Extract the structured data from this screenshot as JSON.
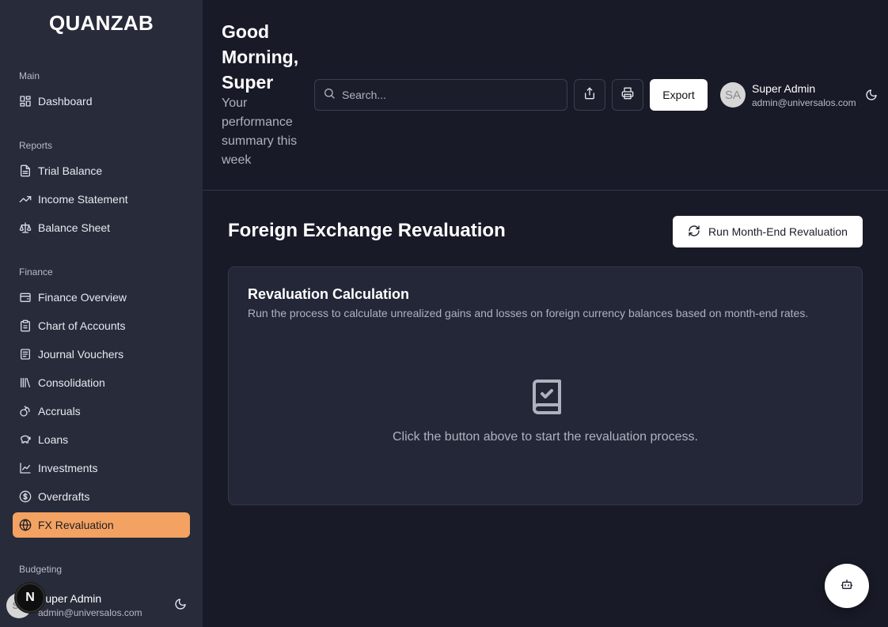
{
  "app": {
    "name": "QUANZAB"
  },
  "sidebar": {
    "sections": {
      "main": "Main",
      "reports": "Reports",
      "finance": "Finance",
      "budgeting": "Budgeting"
    },
    "items": {
      "dashboard": {
        "label": "Dashboard",
        "icon": "layout-dashboard-icon"
      },
      "trial_balance": {
        "label": "Trial Balance",
        "icon": "file-text-icon"
      },
      "income_statement": {
        "label": "Income Statement",
        "icon": "trending-up-icon"
      },
      "balance_sheet": {
        "label": "Balance Sheet",
        "icon": "scale-icon"
      },
      "finance_overview": {
        "label": "Finance Overview",
        "icon": "wallet-icon"
      },
      "chart_of_accounts": {
        "label": "Chart of Accounts",
        "icon": "clipboard-list-icon"
      },
      "journal_vouchers": {
        "label": "Journal Vouchers",
        "icon": "receipt-icon"
      },
      "consolidation": {
        "label": "Consolidation",
        "icon": "library-icon"
      },
      "accruals": {
        "label": "Accruals",
        "icon": "coins-icon"
      },
      "loans": {
        "label": "Loans",
        "icon": "piggy-bank-icon"
      },
      "investments": {
        "label": "Investments",
        "icon": "line-chart-icon"
      },
      "overdrafts": {
        "label": "Overdrafts",
        "icon": "circle-dollar-icon"
      },
      "fx_revaluation": {
        "label": "FX Revaluation",
        "icon": "globe-icon",
        "active": true
      }
    },
    "user": {
      "initials": "SA",
      "name": "Super Admin",
      "email": "admin@universalos.com"
    },
    "dev_badge": "N"
  },
  "header": {
    "greeting": "Good Morning, Super",
    "subtitle": "Your performance summary this week",
    "search_placeholder": "Search...",
    "export_label": "Export",
    "user": {
      "initials": "SA",
      "name": "Super Admin",
      "email": "admin@universalos.com"
    }
  },
  "main": {
    "title": "Foreign Exchange Revaluation",
    "run_button_label": "Run Month-End Revaluation",
    "card": {
      "title": "Revaluation Calculation",
      "description": "Run the process to calculate unrealized gains and losses on foreign currency balances based on month-end rates.",
      "empty_message": "Click the button above to start the revaluation process."
    }
  },
  "colors": {
    "active_nav": "#f4a261",
    "sidebar_bg": "#272b3a",
    "page_bg": "#181a27"
  }
}
